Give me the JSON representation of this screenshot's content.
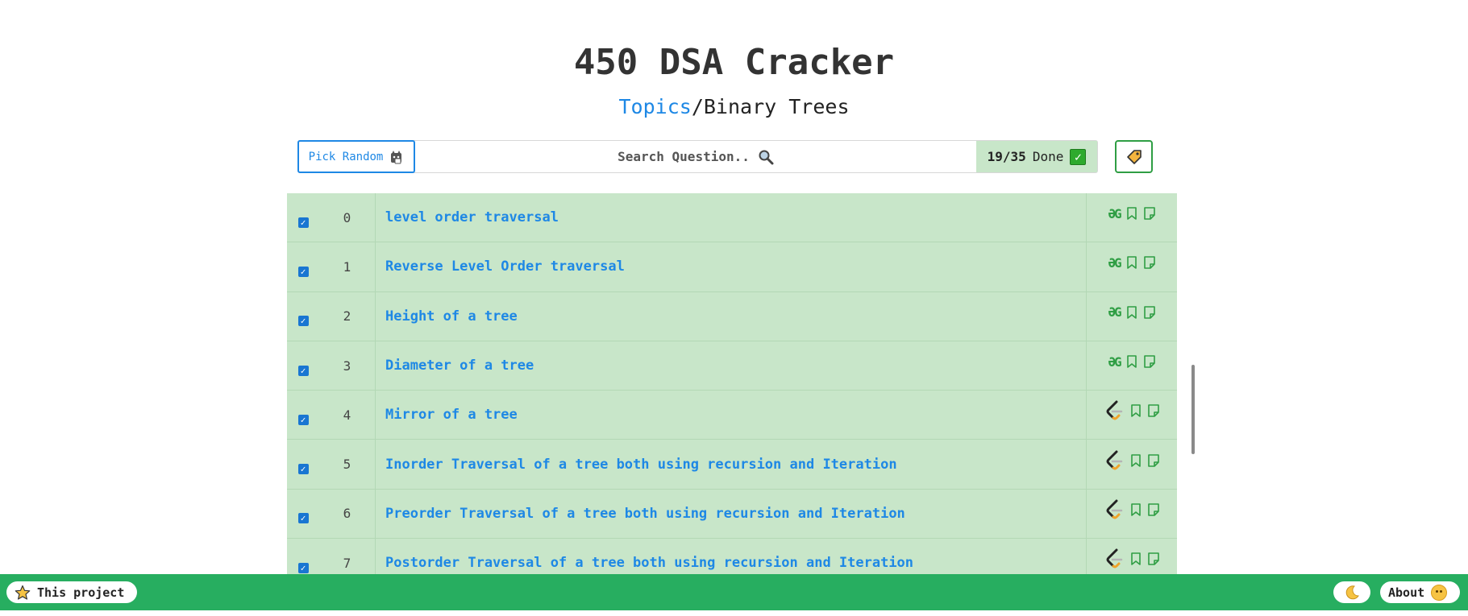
{
  "header": {
    "title": "450 DSA Cracker",
    "breadcrumb_link": "Topics",
    "breadcrumb_sep": "/",
    "breadcrumb_current": "Binary Trees"
  },
  "toolbar": {
    "pick_random_label": "Pick Random",
    "search_placeholder": "Search Question..",
    "done_count": "19/35",
    "done_label": "Done",
    "done_check": "✓"
  },
  "icons": {
    "pick_random": "cat-dice-icon",
    "search": "magnifier-icon",
    "tag": "tag-icon",
    "gfg": "geeksforgeeks-icon",
    "leetcode": "leetcode-icon",
    "bookmark": "bookmark-icon",
    "note": "note-icon",
    "star": "star-icon",
    "moon": "moon-icon",
    "smiley": "smiley-icon"
  },
  "questions": [
    {
      "num": "0",
      "title": "level order traversal",
      "platform": "gfg",
      "checked": "✓"
    },
    {
      "num": "1",
      "title": "Reverse Level Order traversal",
      "platform": "gfg",
      "checked": "✓"
    },
    {
      "num": "2",
      "title": "Height of a tree",
      "platform": "gfg",
      "checked": "✓"
    },
    {
      "num": "3",
      "title": "Diameter of a tree",
      "platform": "gfg",
      "checked": "✓"
    },
    {
      "num": "4",
      "title": "Mirror of a tree",
      "platform": "leetcode",
      "checked": "✓"
    },
    {
      "num": "5",
      "title": "Inorder Traversal of a tree both using recursion and Iteration",
      "platform": "leetcode",
      "checked": "✓"
    },
    {
      "num": "6",
      "title": "Preorder Traversal of a tree both using recursion and Iteration",
      "platform": "leetcode",
      "checked": "✓"
    },
    {
      "num": "7",
      "title": "Postorder Traversal of a tree both using recursion and Iteration",
      "platform": "leetcode",
      "checked": "✓"
    }
  ],
  "gfg_glyph": "ƏG",
  "footer": {
    "project_label": "This project",
    "about_label": "About"
  },
  "colors": {
    "accent_blue": "#1e88e5",
    "row_green": "#c8e6c9",
    "footer_green": "#27ae60",
    "icon_green": "#2f9e44"
  }
}
